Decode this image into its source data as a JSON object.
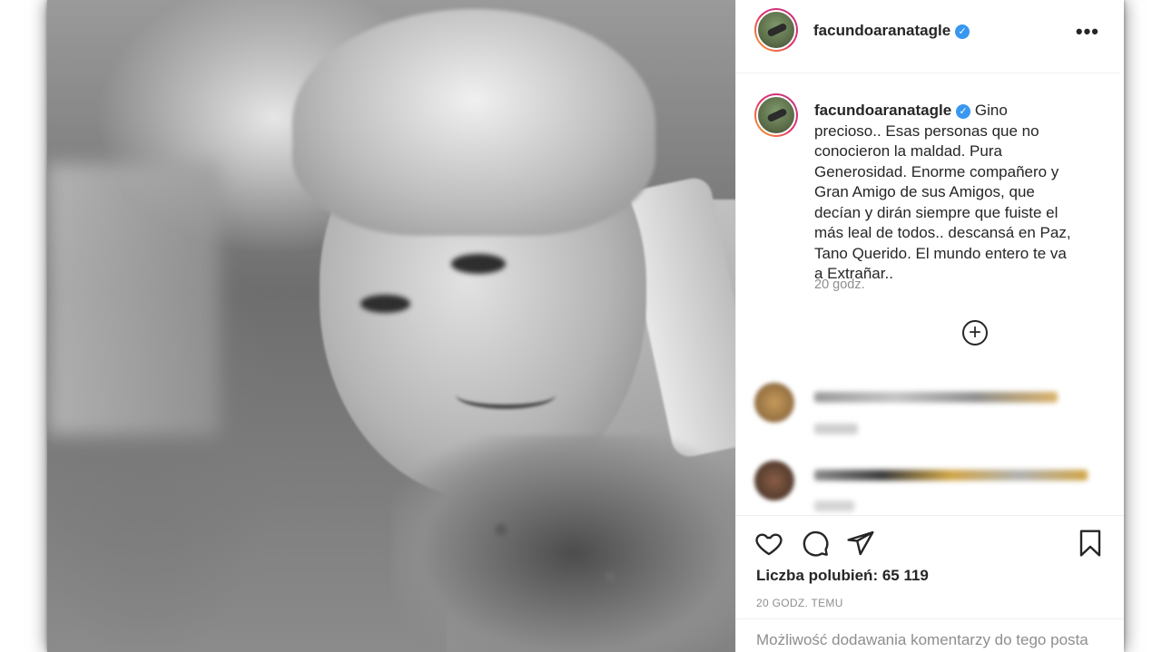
{
  "post": {
    "username": "facundoaranatagle",
    "verified_mark": "✓",
    "more_label": "•••",
    "caption": "Gino precioso.. Esas personas que no conocieron la maldad. Pura Generosidad. Enorme compañero y Gran Amigo de sus Amigos, que decían y dirán siempre que fuiste el más leal de todos.. descansá en Paz, Tano Querido. El mundo entero te va a Extrañar..",
    "caption_time": "20 godz.",
    "load_more_label": "+",
    "likes_label": "Liczba polubień: 65 119",
    "post_time": "20 GODZ. TEMU",
    "comments_disabled": "Możliwość dodawania komentarzy do tego posta"
  },
  "icons": {
    "like": "heart-icon",
    "comment": "speech-bubble-icon",
    "share": "paper-plane-icon",
    "save": "bookmark-icon",
    "verified": "verified-badge-icon",
    "more": "ellipsis-icon"
  },
  "colors": {
    "text": "#262626",
    "muted": "#8e8e8e",
    "verified": "#3897f0",
    "divider": "#efefef"
  }
}
